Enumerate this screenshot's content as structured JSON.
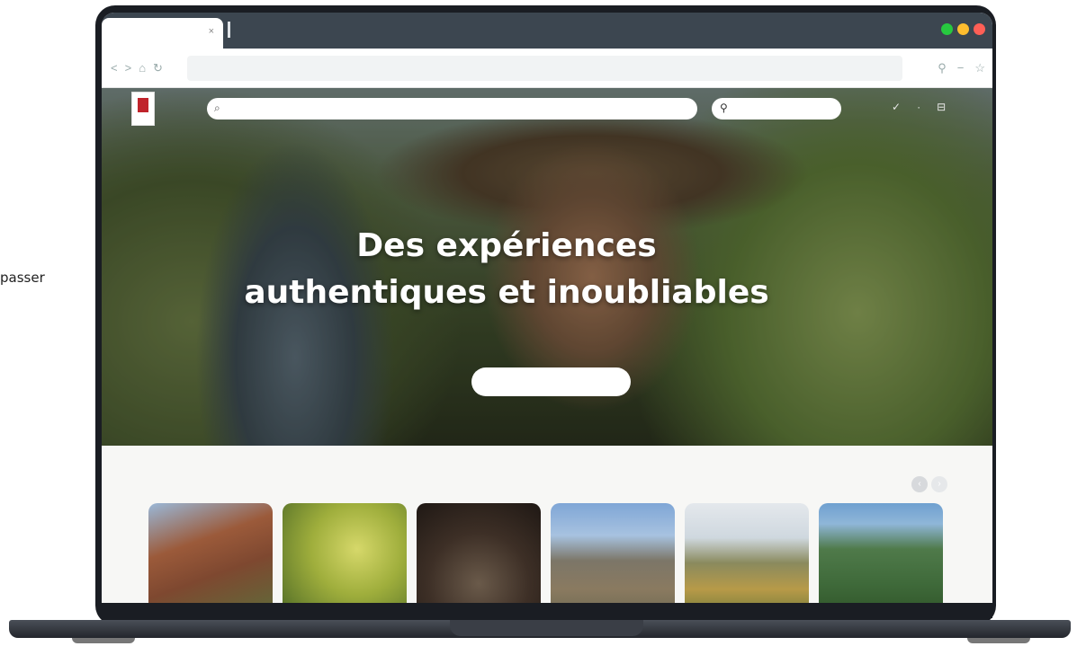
{
  "side_caption": "passer",
  "browser": {
    "tab_close": "×",
    "nav_back": "<",
    "nav_forward": ">",
    "home": "⌂",
    "reload": "↻",
    "ext_icon": "⚲",
    "menu_icon": "−",
    "bookmark_icon": "☆",
    "window_colors": [
      "#27c93f",
      "#ffbd2e",
      "#ff5f56"
    ]
  },
  "site": {
    "search_icon": "⌕",
    "pill_icon": "⚲",
    "hero": {
      "title_line1": "Des expériences",
      "title_line2": "authentiques et inoubliables"
    }
  },
  "regions": {
    "carousel_prev": "‹",
    "carousel_next": "›",
    "cards": [
      {
        "name": "region-card-1"
      },
      {
        "name": "region-card-2"
      },
      {
        "name": "region-card-3"
      },
      {
        "name": "region-card-4"
      },
      {
        "name": "region-card-5"
      },
      {
        "name": "region-card-6"
      }
    ]
  },
  "colors": {
    "heading": "#1d2540",
    "accent_red": "#c0232b",
    "nav_dot": "#ffffff"
  }
}
